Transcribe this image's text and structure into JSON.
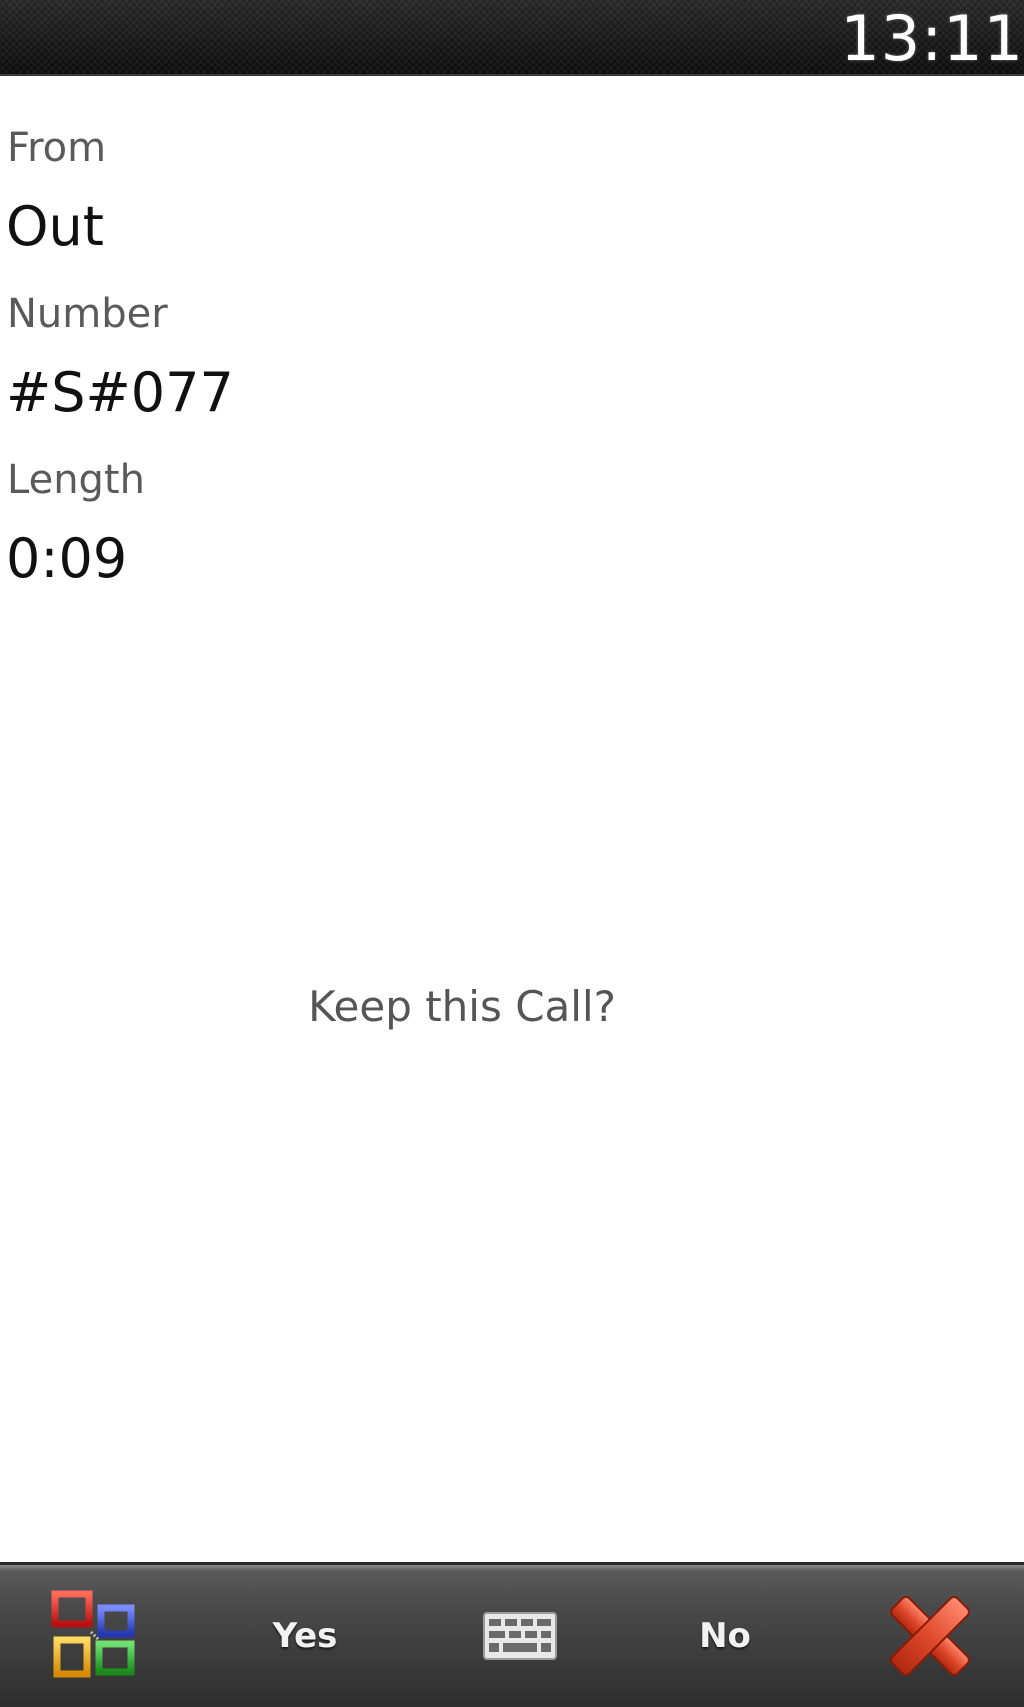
{
  "status_bar": {
    "time": "13:11"
  },
  "call_details": {
    "from_label": "From",
    "from_value": "Out",
    "number_label": "Number",
    "number_value": "#S#077",
    "length_label": "Length",
    "length_value": "0:09"
  },
  "prompt": "Keep this Call?",
  "softkeys": {
    "yes_label": "Yes",
    "no_label": "No"
  },
  "icons": {
    "start": "windows-start-icon",
    "keyboard": "keyboard-icon",
    "close": "close-x-icon"
  },
  "colors": {
    "close_red": "#e04a2c",
    "start_red": "#d02020",
    "start_blue": "#3a4fd0",
    "start_yellow": "#f0b020",
    "start_green": "#2aa02a"
  }
}
